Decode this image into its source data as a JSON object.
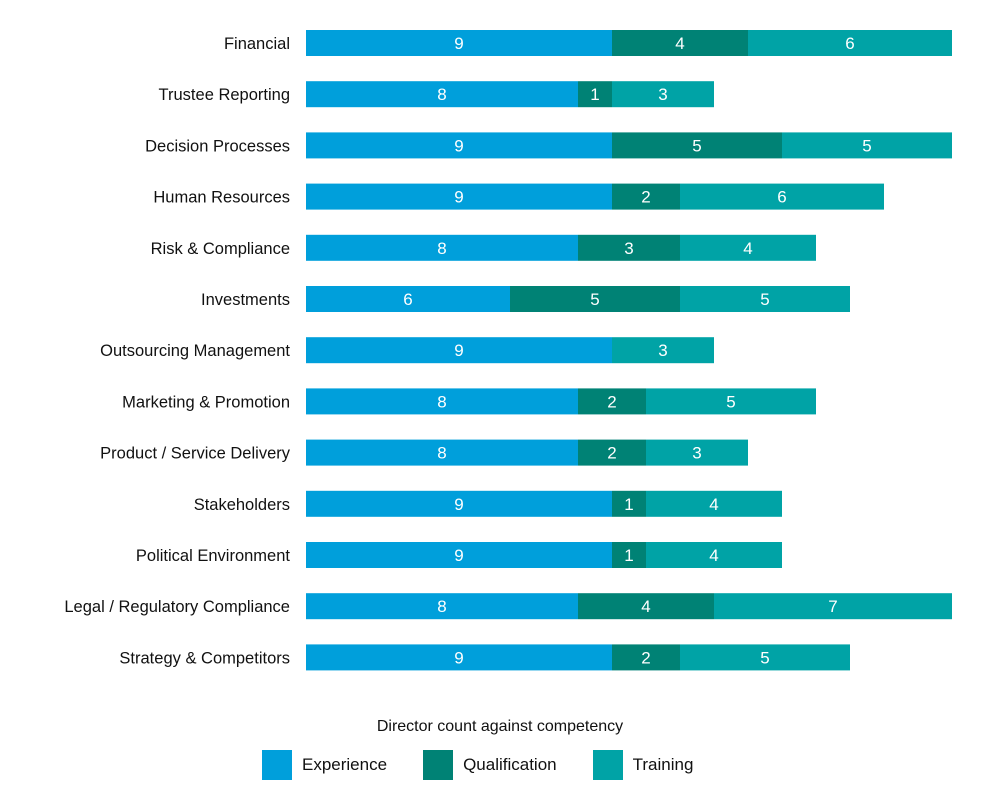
{
  "chart_data": {
    "type": "bar",
    "orientation": "horizontal",
    "stacked": true,
    "title": "",
    "xlabel": "",
    "ylabel": "",
    "legend_title": "Director count against competency",
    "legend_position": "bottom",
    "grid": false,
    "xlim": [
      0,
      19
    ],
    "categories": [
      "Financial",
      "Trustee Reporting",
      "Decision Processes",
      "Human Resources",
      "Risk & Compliance",
      "Investments",
      "Outsourcing Management",
      "Marketing & Promotion",
      "Product / Service Delivery",
      "Stakeholders",
      "Political Environment",
      "Legal / Regulatory Compliance",
      "Strategy & Competitors"
    ],
    "series": [
      {
        "name": "Experience",
        "color": "#009fdb",
        "values": [
          9,
          8,
          9,
          9,
          8,
          6,
          9,
          8,
          8,
          9,
          9,
          8,
          9
        ]
      },
      {
        "name": "Qualification",
        "color": "#008275",
        "values": [
          4,
          1,
          5,
          2,
          3,
          5,
          0,
          2,
          2,
          1,
          1,
          4,
          2
        ]
      },
      {
        "name": "Training",
        "color": "#00a3a6",
        "values": [
          6,
          3,
          5,
          6,
          4,
          5,
          3,
          5,
          3,
          4,
          4,
          7,
          5
        ]
      }
    ]
  }
}
